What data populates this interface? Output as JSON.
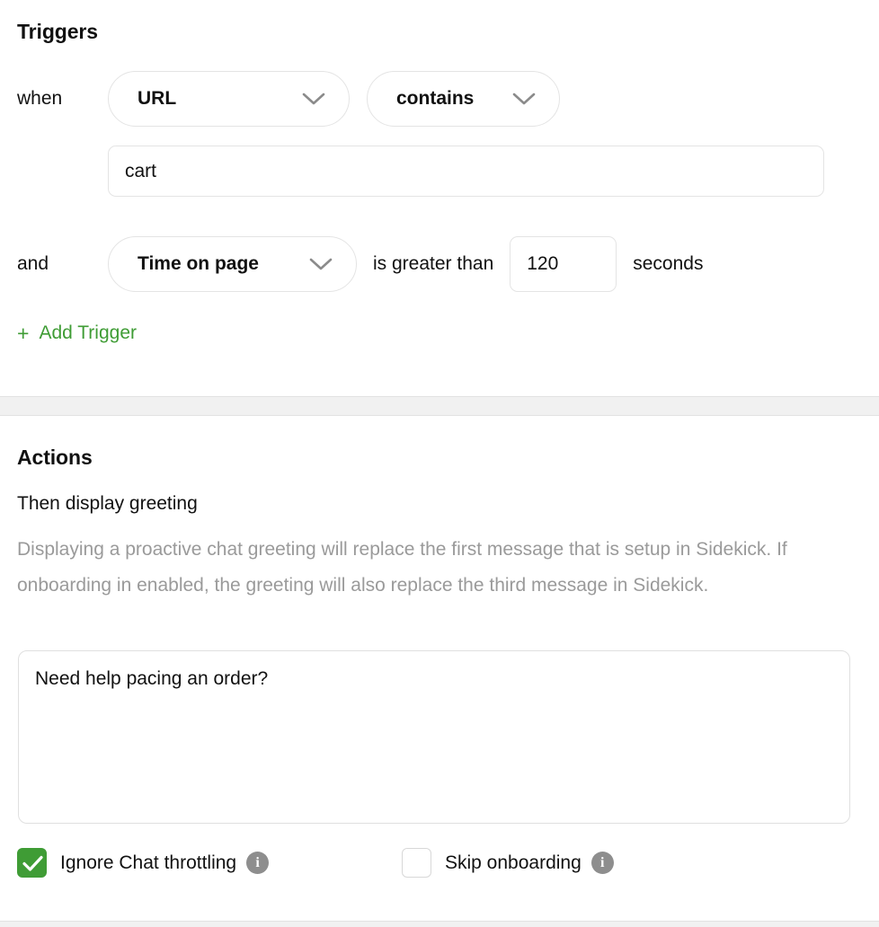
{
  "triggers": {
    "title": "Triggers",
    "rows": [
      {
        "conjunction": "when",
        "field": "URL",
        "operator": "contains",
        "value": "cart"
      },
      {
        "conjunction": "and",
        "field": "Time on page",
        "comparator": "is greater than",
        "value": "120",
        "unit": "seconds"
      }
    ],
    "add_trigger_plus": "+",
    "add_trigger_label": "Add Trigger",
    "accent_color": "#3f9c35"
  },
  "actions": {
    "title": "Actions",
    "subtitle": "Then display greeting",
    "description": "Displaying a proactive chat greeting will replace the first message that is setup in Sidekick. If onboarding in enabled, the greeting will also replace the third message in Sidekick.",
    "greeting_value": "Need help pacing an order?",
    "options": [
      {
        "label": "Ignore Chat throttling",
        "checked": true,
        "info": "i"
      },
      {
        "label": "Skip onboarding",
        "checked": false,
        "info": "i"
      }
    ]
  }
}
